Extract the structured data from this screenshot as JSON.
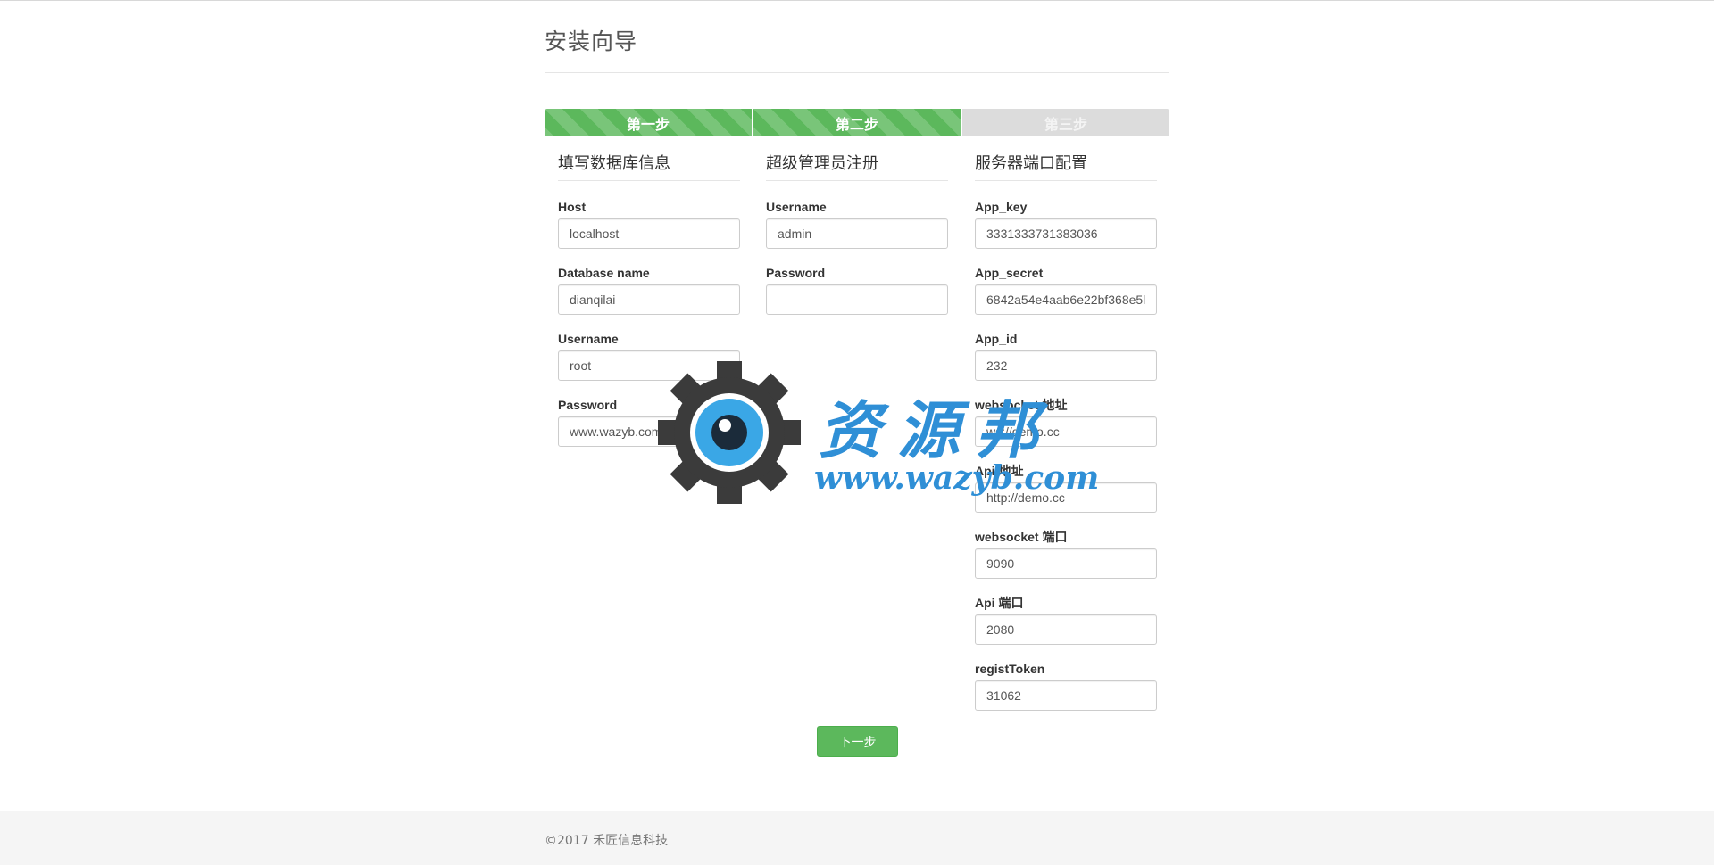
{
  "page": {
    "title": "安装向导"
  },
  "steps": [
    {
      "label": "第一步",
      "state": "done"
    },
    {
      "label": "第二步",
      "state": "done"
    },
    {
      "label": "第三步",
      "state": "todo"
    }
  ],
  "database": {
    "heading": "填写数据库信息",
    "host_label": "Host",
    "host_value": "localhost",
    "dbname_label": "Database name",
    "dbname_value": "dianqilai",
    "username_label": "Username",
    "username_value": "root",
    "password_label": "Password",
    "password_value": "www.wazyb.com"
  },
  "admin": {
    "heading": "超级管理员注册",
    "username_label": "Username",
    "username_value": "admin",
    "password_label": "Password",
    "password_value": ""
  },
  "server": {
    "heading": "服务器端口配置",
    "app_key_label": "App_key",
    "app_key_value": "3331333731383036",
    "app_secret_label": "App_secret",
    "app_secret_value": "6842a54e4aab6e22bf368e5l",
    "app_id_label": "App_id",
    "app_id_value": "232",
    "ws_addr_label": "websocket 地址",
    "ws_addr_value": "ws://demo.cc",
    "api_addr_label": "Api 地址",
    "api_addr_value": "http://demo.cc",
    "ws_port_label": "websocket 端口",
    "ws_port_value": "9090",
    "api_port_label": "Api 端口",
    "api_port_value": "2080",
    "token_label": "registToken",
    "token_value": "31062"
  },
  "actions": {
    "next_label": "下一步"
  },
  "footer": {
    "text": "©2017 禾匠信息科技"
  },
  "watermark": {
    "title": "资源邦",
    "url": "www.wazyb.com"
  },
  "colors": {
    "accent": "#5cb85c",
    "step_todo": "#dcdcdc",
    "watermark": "#2f8fd6"
  }
}
